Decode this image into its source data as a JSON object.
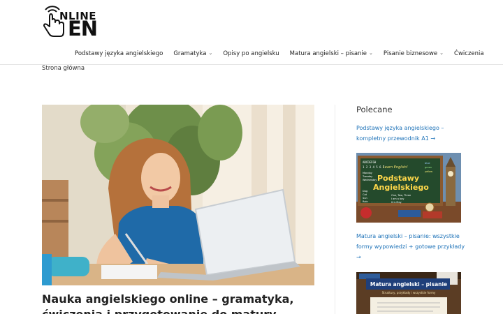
{
  "brand": {
    "logo_top": "NLINE",
    "logo_bottom": "EN"
  },
  "nav": {
    "items": [
      {
        "label": "Podstawy języka angielskiego",
        "dropdown": false
      },
      {
        "label": "Gramatyka",
        "dropdown": true
      },
      {
        "label": "Opisy po angielsku",
        "dropdown": false
      },
      {
        "label": "Matura angielski – pisanie",
        "dropdown": true
      },
      {
        "label": "Pisanie biznesowe",
        "dropdown": true
      },
      {
        "label": "Ćwiczenia",
        "dropdown": false
      }
    ]
  },
  "breadcrumb": {
    "home": "Strona główna"
  },
  "article": {
    "title": "Nauka angielskiego online – gramatyka, ćwiczenia i przygotowanie do matury"
  },
  "sidebar": {
    "widget_title": "Polecane",
    "posts": [
      {
        "title": "Podstawy języka angielskiego – kompletny przewodnik A1 →"
      },
      {
        "title": "Matura angielski – pisanie: wszystkie formy wypowiedzi + gotowe przykłady →"
      }
    ],
    "img1": {
      "board_small": "Learn English!",
      "title_line1": "Podstawy",
      "title_line2": "Angielskiego",
      "alphabet": "ABCDEFGH",
      "numbers": "1 2 3 4 5 6 7",
      "days": [
        "Monday",
        "Tuesday",
        "Wednesday"
      ],
      "words": [
        "blue",
        "green",
        "yellow"
      ],
      "animals": [
        "Dog",
        "Cat",
        "Sun",
        "Rain"
      ],
      "phrases": [
        "One, Two, Three",
        "I am a boy",
        "It is May"
      ]
    },
    "img2": {
      "title": "Matura angielski – pisanie",
      "subtitle": "Struktury, przykłady i wszystkie formy"
    }
  },
  "colors": {
    "link": "#1d72b8",
    "text": "#222222"
  }
}
